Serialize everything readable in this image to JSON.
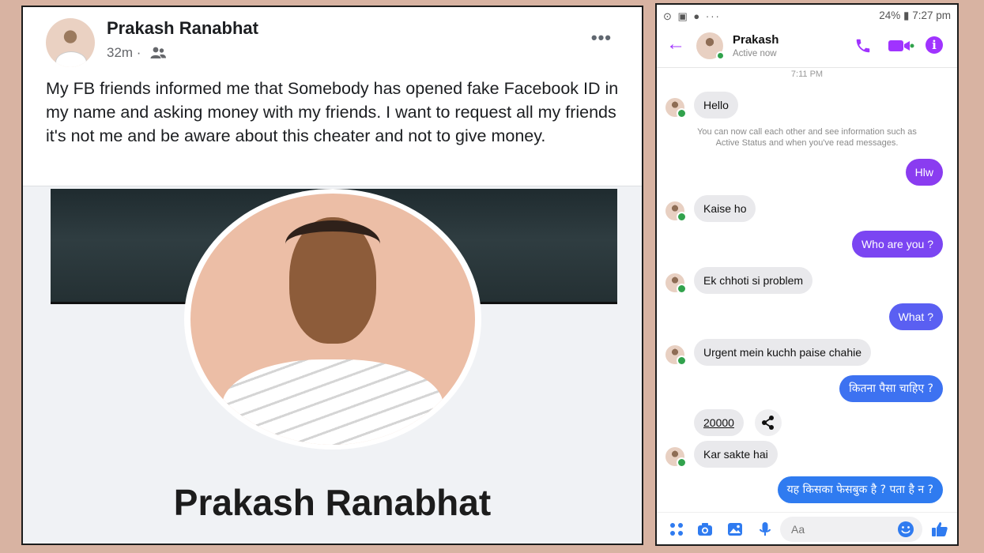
{
  "facebook_post": {
    "author": "Prakash Ranabhat",
    "time": "32m ·",
    "more_icon": "more-horizontal-icon",
    "audience_icon": "friends-icon",
    "body": "My FB friends informed me that Somebody has opened fake Facebook ID in my name and asking money with my friends. I want to request all my friends it's not me and be aware about this cheater and not to give money.",
    "profile_image_name": "Prakash Ranabhat"
  },
  "messenger": {
    "status_bar": {
      "left_icons": "⊙ ▣ ● ···",
      "right": "24% ▮ 7:27 pm"
    },
    "header": {
      "name": "Prakash",
      "status": "Active now"
    },
    "timestamp": "7:11 PM",
    "notice": "You can now call each other and see information such as Active Status and when you've read messages.",
    "messages": [
      {
        "from": "them",
        "text": "Hello"
      },
      {
        "from": "me",
        "text": "Hlw"
      },
      {
        "from": "them",
        "text": "Kaise ho"
      },
      {
        "from": "me",
        "text": "Who are you ?"
      },
      {
        "from": "them",
        "text": "Ek chhoti si problem"
      },
      {
        "from": "me",
        "text": "What ?"
      },
      {
        "from": "them",
        "text": "Urgent mein kuchh paise chahie"
      },
      {
        "from": "me",
        "text": "कितना पैसा चाहिए ?"
      },
      {
        "from": "them",
        "text": "20000"
      },
      {
        "from": "them",
        "text": "Kar sakte hai"
      },
      {
        "from": "me",
        "text": "यह किसका फेसबुक है ? पता है न ?"
      }
    ],
    "composer": {
      "placeholder": "Aa"
    },
    "colors": {
      "accent": "#a033ff",
      "bubble_purple": "#8a3cf0",
      "bubble_blue": "#2f7bf0",
      "bubble_incoming": "#e9e9ec",
      "active_green": "#31a24c"
    }
  }
}
